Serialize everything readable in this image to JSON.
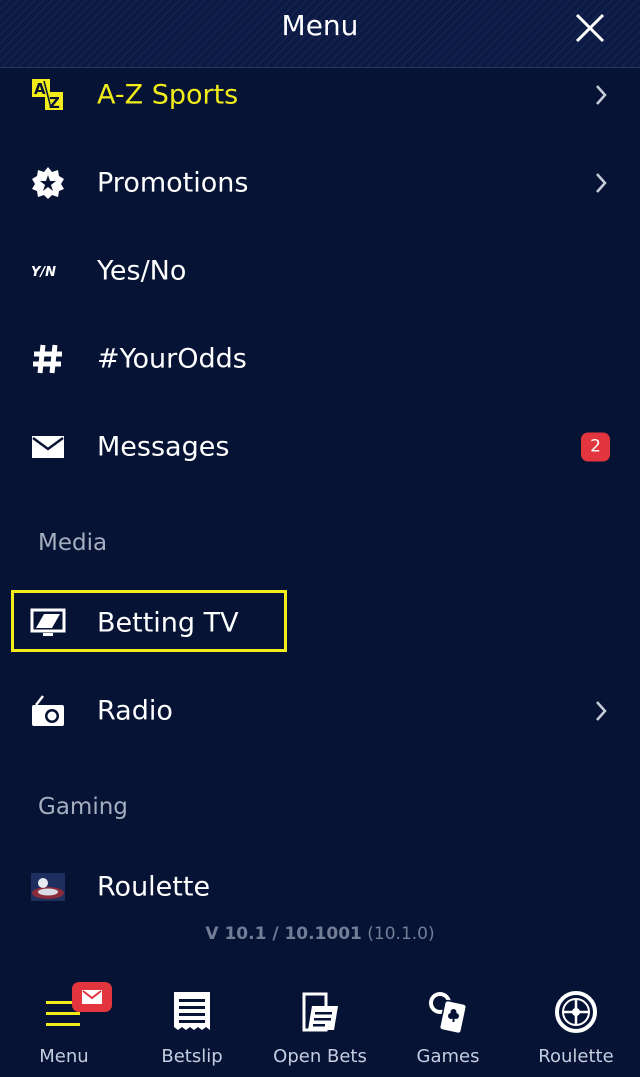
{
  "header": {
    "title": "Menu"
  },
  "menu_items": [
    {
      "label": "A-Z Sports",
      "icon": "az-sports-icon",
      "highlight_color": "#f2ec1a"
    },
    {
      "label": "Promotions",
      "icon": "star-badge-icon"
    },
    {
      "label": "Yes/No",
      "icon": "yes-no-icon"
    },
    {
      "label": "#YourOdds",
      "icon": "hashtag-icon"
    },
    {
      "label": "Messages",
      "icon": "envelope-icon",
      "badge": "2"
    }
  ],
  "sections": {
    "media": {
      "title": "Media",
      "items": [
        {
          "label": "Betting TV",
          "icon": "tv-icon"
        },
        {
          "label": "Radio",
          "icon": "radio-icon"
        }
      ]
    },
    "gaming": {
      "title": "Gaming",
      "items": [
        {
          "label": "Roulette",
          "icon": "roulette-thumbnail-icon"
        }
      ]
    }
  },
  "version": {
    "main": "V 10.1 / 10.1001",
    "build": "(10.1.0)"
  },
  "tabbar": {
    "tabs": [
      {
        "label": "Menu",
        "icon": "hamburger-icon",
        "has_mail_badge": true
      },
      {
        "label": "Betslip",
        "icon": "betslip-icon"
      },
      {
        "label": "Open Bets",
        "icon": "open-bets-icon"
      },
      {
        "label": "Games",
        "icon": "playing-cards-icon"
      },
      {
        "label": "Roulette",
        "icon": "roulette-wheel-icon"
      }
    ]
  },
  "colors": {
    "background": "#061335",
    "accent_yellow": "#f2ec1a",
    "badge_red": "#e2353d"
  }
}
